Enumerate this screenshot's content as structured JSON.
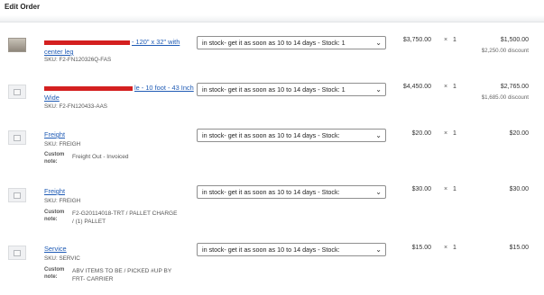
{
  "header": {
    "title": "Edit Order"
  },
  "icons": {
    "placeholder": "image-placeholder-icon",
    "photo": "product-photo-icon",
    "dropdown": "chevron-down-icon"
  },
  "items": [
    {
      "name_visible": "- 120\" x 32\" with center leg",
      "sku": "SKU: F2-FN120326Q-FAS",
      "stock": "in stock- get it as soon as 10 to 14 days - Stock: 1",
      "price": "$3,750.00",
      "qty": "1",
      "total": "$1,500.00",
      "discount": "$2,250.00 discount"
    },
    {
      "name_visible": "le - 10 foot - 43 Inch Wide",
      "sku": "SKU: F2-FN120433-AAS",
      "stock": "in stock- get it as soon as 10 to 14 days - Stock: 1",
      "price": "$4,450.00",
      "qty": "1",
      "total": "$2,765.00",
      "discount": "$1,685.00 discount"
    },
    {
      "name": "Freight",
      "sku": "SKU: FREIGH",
      "note_label": "Custom note:",
      "note": "Freight Out - Invoiced",
      "stock": "in stock- get it as soon as 10 to 14 days - Stock:",
      "price": "$20.00",
      "qty": "1",
      "total": "$20.00"
    },
    {
      "name": "Freight",
      "sku": "SKU: FREIGH",
      "note_label": "Custom note:",
      "note": "F2-G20114018-TRT / PALLET CHARGE / (1) PALLET",
      "stock": "in stock- get it as soon as 10 to 14 days - Stock:",
      "price": "$30.00",
      "qty": "1",
      "total": "$30.00"
    },
    {
      "name": "Service",
      "sku": "SKU: SERVIC",
      "note_label": "Custom note:",
      "note": "ABV ITEMS TO BE / PICKED #UP BY FRT- CARRIER",
      "stock": "in stock- get it as soon as 10 to 14 days - Stock:",
      "price": "$15.00",
      "qty": "1",
      "total": "$15.00"
    }
  ],
  "qty_prefix": "×"
}
